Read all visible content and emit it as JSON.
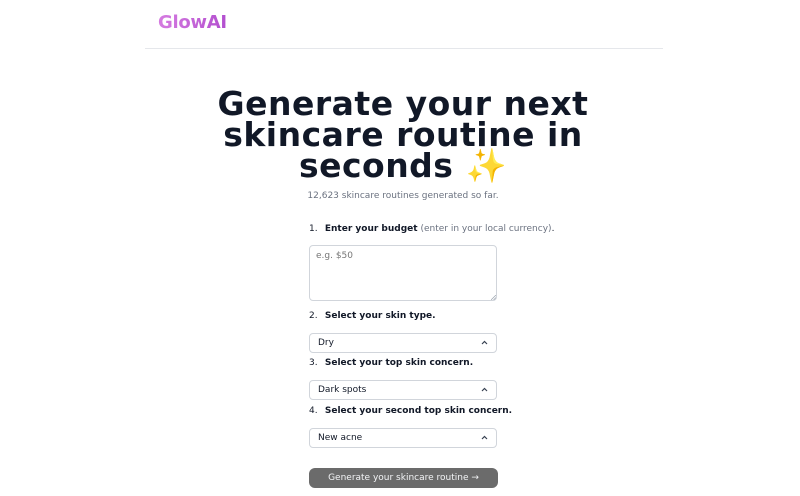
{
  "brand": {
    "name": "GlowAI"
  },
  "hero": {
    "line1": "Generate your next",
    "line2": "skincare routine in",
    "line3": "seconds",
    "emoji": "✨"
  },
  "counter": "12,623 skincare routines generated so far.",
  "steps": [
    {
      "num": "1.",
      "label": "Enter your budget",
      "hint": "(enter in your local currency)",
      "suffix": "."
    },
    {
      "num": "2.",
      "label": "Select your skin type."
    },
    {
      "num": "3.",
      "label": "Select your top skin concern."
    },
    {
      "num": "4.",
      "label": "Select your second top skin concern."
    }
  ],
  "budget": {
    "placeholder": "e.g. $50",
    "value": ""
  },
  "selects": {
    "skin_type": "Dry",
    "top_concern": "Dark spots",
    "second_concern": "New acne"
  },
  "submit": {
    "label": "Generate your skincare routine →"
  },
  "icons": {
    "chevron": "chevron-up-down-icon",
    "grip": "resize-grip-icon"
  },
  "colors": {
    "brand": "#c26bd6",
    "button": "#6b6b6b",
    "text": "#111827",
    "muted": "#6b7280"
  }
}
